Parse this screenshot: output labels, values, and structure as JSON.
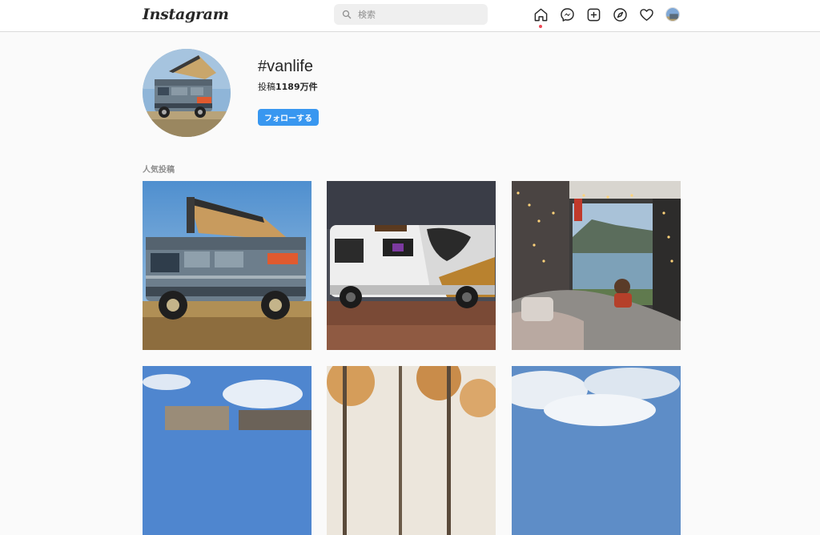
{
  "app": {
    "logo": "Instagram",
    "search_placeholder": "検索"
  },
  "nav": {
    "icons": [
      "home-icon",
      "messenger-icon",
      "new-post-icon",
      "explore-icon",
      "activity-heart-icon",
      "profile-avatar"
    ],
    "active": "home-icon",
    "accent_color": "#ed4956"
  },
  "hashtag": {
    "title": "#vanlife",
    "posts_label": "投稿",
    "posts_count": "1189万件",
    "follow_label": "フォローする",
    "follow_color": "#3897f0"
  },
  "section": {
    "top_posts_label": "人気投稿"
  },
  "posts": [
    {
      "name": "post-vw-camper-van"
    },
    {
      "name": "post-tiger-sprinter-van"
    },
    {
      "name": "post-van-interior-lake-view"
    },
    {
      "name": "post-blue-sky-ruins"
    },
    {
      "name": "post-autumn-trees"
    },
    {
      "name": "post-cloudy-sky"
    }
  ]
}
